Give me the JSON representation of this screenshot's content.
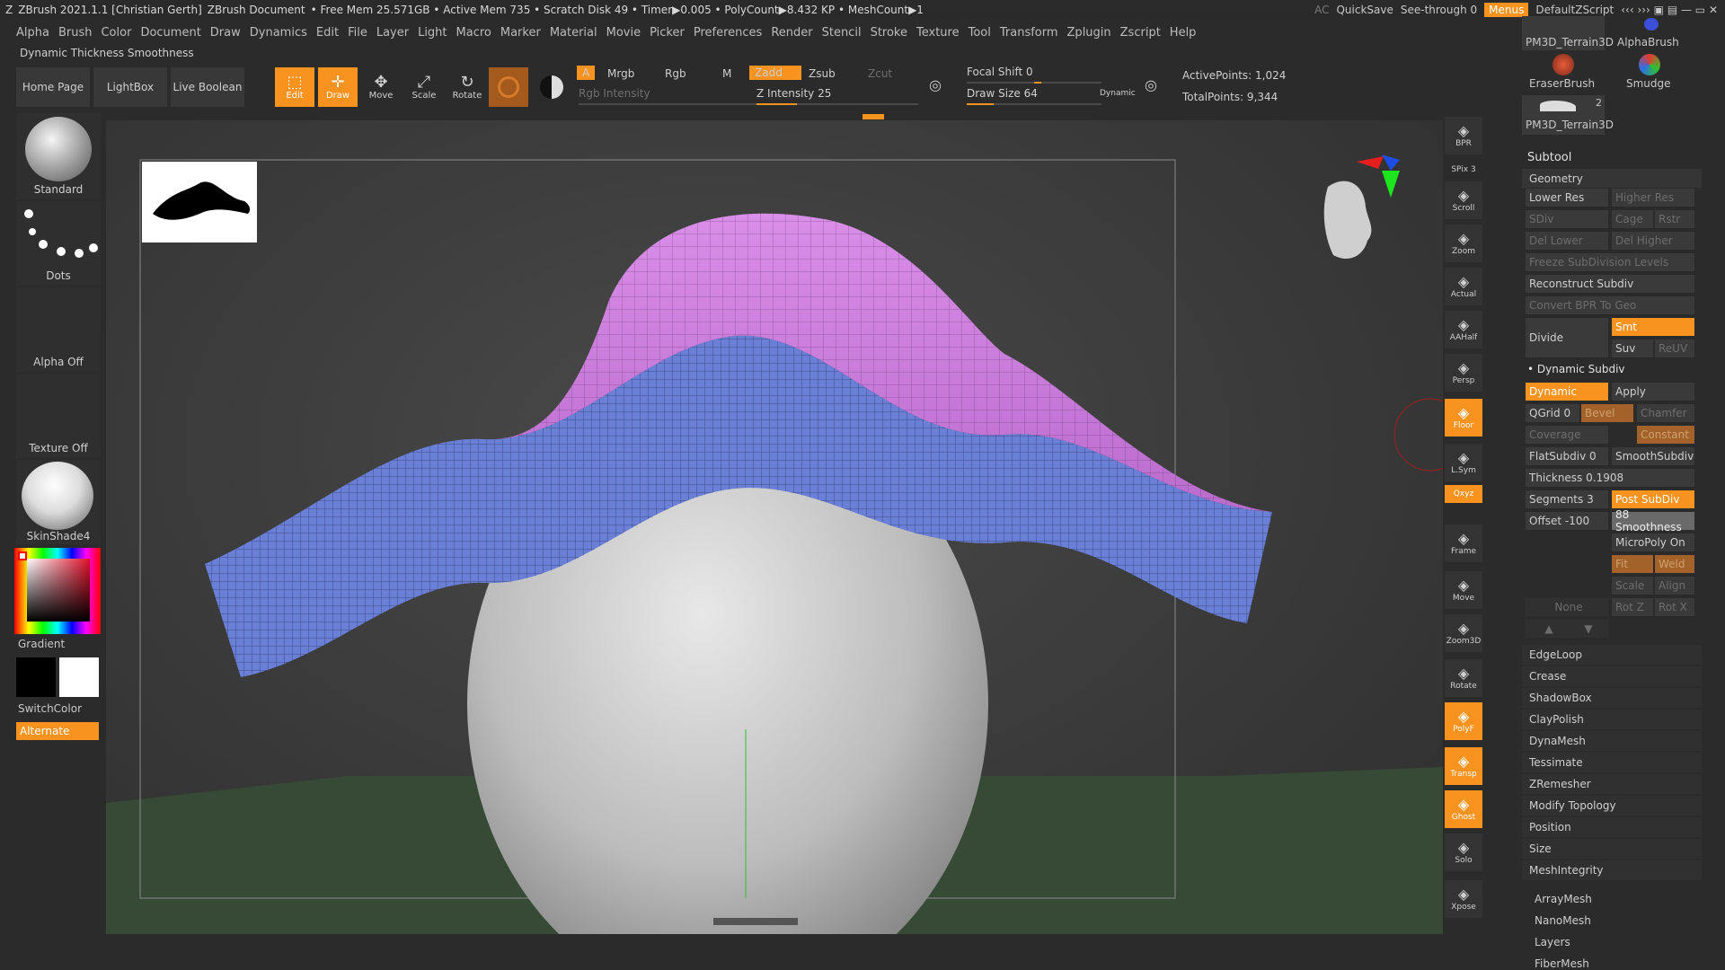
{
  "titlebar": {
    "app": "ZBrush 2021.1.1 [Christian Gerth]",
    "doc": "ZBrush Document",
    "stats": "• Free Mem 25.571GB • Active Mem 735 • Scratch Disk 49 • Timer▶0.005 • PolyCount▶8.432 KP • MeshCount▶1",
    "ac": "AC",
    "quicksave": "QuickSave",
    "seethrough": "See-through  0",
    "menus": "Menus",
    "script": "DefaultZScript"
  },
  "menubar": [
    "Alpha",
    "Brush",
    "Color",
    "Document",
    "Draw",
    "Dynamics",
    "Edit",
    "File",
    "Layer",
    "Light",
    "Macro",
    "Marker",
    "Material",
    "Movie",
    "Picker",
    "Preferences",
    "Render",
    "Stencil",
    "Stroke",
    "Texture",
    "Tool",
    "Transform",
    "Zplugin",
    "Zscript",
    "Help"
  ],
  "tipline": "Dynamic Thickness Smoothness",
  "toolbar": {
    "home": "Home Page",
    "lightbox": "LightBox",
    "liveboolean": "Live Boolean",
    "edit": "Edit",
    "draw": "Draw",
    "move": "Move",
    "scale": "Scale",
    "rotate": "Rotate",
    "a": "A",
    "mrgb": "Mrgb",
    "rgb": "Rgb",
    "m": "M",
    "rgb_intensity": "Rgb Intensity",
    "zadd": "Zadd",
    "zsub": "Zsub",
    "zcut": "Zcut",
    "z_intensity": "Z Intensity 25",
    "focal_shift": "Focal Shift 0",
    "draw_size": "Draw Size 64",
    "dynamic": "Dynamic",
    "active_points": "ActivePoints: 1,024",
    "total_points": "TotalPoints: 9,344",
    "z_intensity_value": 25,
    "focal_shift_value": 0,
    "draw_size_value": 64
  },
  "leftshelf": {
    "brush": "Standard",
    "stroke": "Dots",
    "alpha": "Alpha Off",
    "texture": "Texture Off",
    "material": "SkinShade4",
    "gradient": "Gradient",
    "switchcolor": "SwitchColor",
    "alternate": "Alternate"
  },
  "righttools": [
    {
      "name": "bpr",
      "label": "BPR"
    },
    {
      "name": "spix",
      "label": "SPix 3"
    },
    {
      "name": "scroll",
      "label": "Scroll"
    },
    {
      "name": "zoom",
      "label": "Zoom"
    },
    {
      "name": "actual",
      "label": "Actual"
    },
    {
      "name": "aahalf",
      "label": "AAHalf"
    },
    {
      "name": "persp",
      "label": "Persp"
    },
    {
      "name": "floor",
      "label": "Floor"
    },
    {
      "name": "lsym",
      "label": "L.Sym"
    },
    {
      "name": "xyz",
      "label": "Qxyz"
    },
    {
      "name": "frame",
      "label": "Frame"
    },
    {
      "name": "move",
      "label": "Move"
    },
    {
      "name": "zoom3d",
      "label": "Zoom3D"
    },
    {
      "name": "rotate",
      "label": "Rotate"
    },
    {
      "name": "polyf",
      "label": "PolyF"
    },
    {
      "name": "transp",
      "label": "Transp"
    },
    {
      "name": "ghost",
      "label": "Ghost"
    },
    {
      "name": "solo",
      "label": "Solo"
    },
    {
      "name": "xpose",
      "label": "Xpose"
    }
  ],
  "rightpanel": {
    "thumbs": [
      "PM3D_Terrain3D",
      "AlphaBrush",
      "EraserBrush",
      "Smudge",
      "PM3D_Terrain3D"
    ],
    "thumb_count": "2",
    "subtool": "Subtool",
    "geometry": "Geometry",
    "lower_res": "Lower Res",
    "higher_res": "Higher Res",
    "sdiv": "SDiv",
    "cage": "Cage",
    "rstr": "Rstr",
    "del_lower": "Del Lower",
    "del_higher": "Del Higher",
    "freeze": "Freeze SubDivision Levels",
    "reconstruct": "Reconstruct Subdiv",
    "convert_bpr": "Convert BPR To Geo",
    "divide": "Divide",
    "smt": "Smt",
    "suv": "Suv",
    "reuv": "ReUV",
    "dynamic_subdiv": "Dynamic Subdiv",
    "dynamic": "Dynamic",
    "apply": "Apply",
    "qgrid": "QGrid 0",
    "bevel": "Bevel",
    "chamfer": "Chamfer",
    "coverage": "Coverage",
    "constant": "Constant",
    "flatsubdiv": "FlatSubdiv 0",
    "smoothsubdiv": "SmoothSubdiv",
    "thickness": "Thickness 0.1908",
    "segments": "Segments 3",
    "post_subdiv": "Post SubDiv",
    "offset": "Offset -100",
    "smoothness": "88 Smoothness",
    "micropoly": "MicroPoly On",
    "fit": "Fit",
    "weld": "Weld",
    "scale": "Scale",
    "align": "Align",
    "none": "None",
    "rotz": "Rot Z",
    "rotx": "Rot X",
    "sections": [
      "EdgeLoop",
      "Crease",
      "ShadowBox",
      "ClayPolish",
      "DynaMesh",
      "Tessimate",
      "ZRemesher",
      "Modify Topology",
      "Position",
      "Size",
      "MeshIntegrity"
    ],
    "subsections": [
      "ArrayMesh",
      "NanoMesh",
      "Layers",
      "FiberMesh"
    ]
  },
  "colors": {
    "accent": "#f7931e",
    "mesh_top": "#c77ad9",
    "mesh_side": "#6a7fd6",
    "floor": "#3b5a3a"
  }
}
